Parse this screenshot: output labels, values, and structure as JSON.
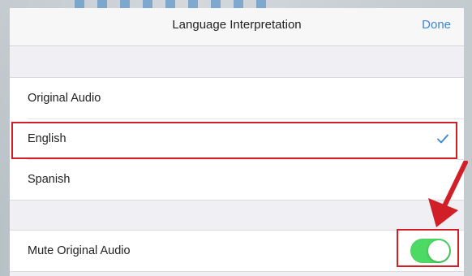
{
  "nav": {
    "title": "Language Interpretation",
    "done_label": "Done"
  },
  "languages": {
    "options": [
      {
        "label": "Original Audio",
        "selected": false
      },
      {
        "label": "English",
        "selected": true
      },
      {
        "label": "Spanish",
        "selected": false
      }
    ],
    "selected_icon": "checkmark-icon"
  },
  "settings": {
    "mute_label": "Mute Original Audio",
    "mute_enabled": true
  },
  "colors": {
    "accent": "#3a86d6",
    "toggle_on": "#4cd964",
    "annotation": "#d11f27"
  }
}
